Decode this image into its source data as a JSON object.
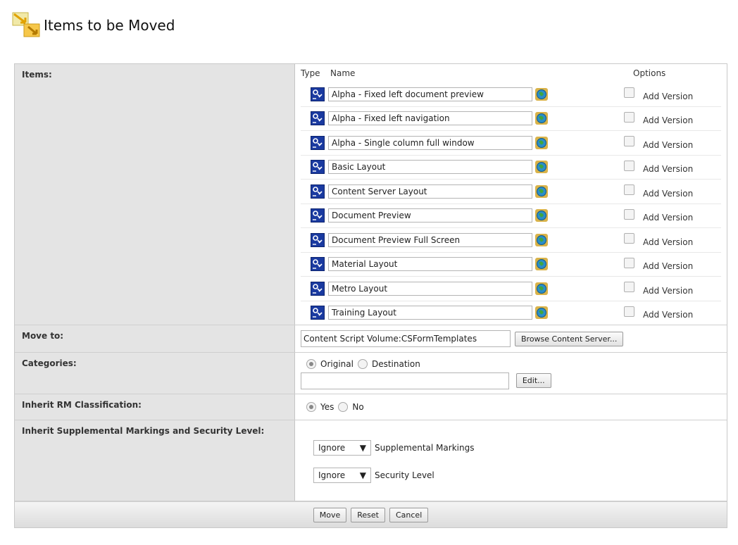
{
  "page": {
    "title": "Items to be Moved",
    "title_icon": "move-arrows-icon"
  },
  "items": {
    "label": "Items:",
    "headers": {
      "type": "Type",
      "name": "Name",
      "options": "Options"
    },
    "rows": [
      {
        "name": "Alpha - Fixed left document preview",
        "option": "Add Version",
        "checked": false
      },
      {
        "name": "Alpha - Fixed left navigation",
        "option": "Add Version",
        "checked": false
      },
      {
        "name": "Alpha - Single column full window",
        "option": "Add Version",
        "checked": false
      },
      {
        "name": "Basic Layout",
        "option": "Add Version",
        "checked": false
      },
      {
        "name": "Content Server Layout",
        "option": "Add Version",
        "checked": false
      },
      {
        "name": "Document Preview",
        "option": "Add Version",
        "checked": false
      },
      {
        "name": "Document Preview Full Screen",
        "option": "Add Version",
        "checked": false
      },
      {
        "name": "Material Layout",
        "option": "Add Version",
        "checked": false
      },
      {
        "name": "Metro Layout",
        "option": "Add Version",
        "checked": false
      },
      {
        "name": "Training Layout",
        "option": "Add Version",
        "checked": false
      }
    ]
  },
  "move_to": {
    "label": "Move to:",
    "value": "Content Script Volume:CSFormTemplates",
    "browse_label": "Browse Content Server..."
  },
  "categories": {
    "label": "Categories:",
    "original_label": "Original",
    "destination_label": "Destination",
    "selected": "Original",
    "edit_label": "Edit..."
  },
  "inherit_rm": {
    "label": "Inherit RM Classification:",
    "yes_label": "Yes",
    "no_label": "No",
    "selected": "Yes"
  },
  "inherit_supp": {
    "label": "Inherit Supplemental Markings and Security Level:",
    "markings_value": "Ignore",
    "markings_label": "Supplemental Markings",
    "security_value": "Ignore",
    "security_label": "Security Level"
  },
  "footer": {
    "move_label": "Move",
    "reset_label": "Reset",
    "cancel_label": "Cancel"
  },
  "colors": {
    "label_bg": "#e4e4e4",
    "icon_blue": "#1a3aa0"
  }
}
